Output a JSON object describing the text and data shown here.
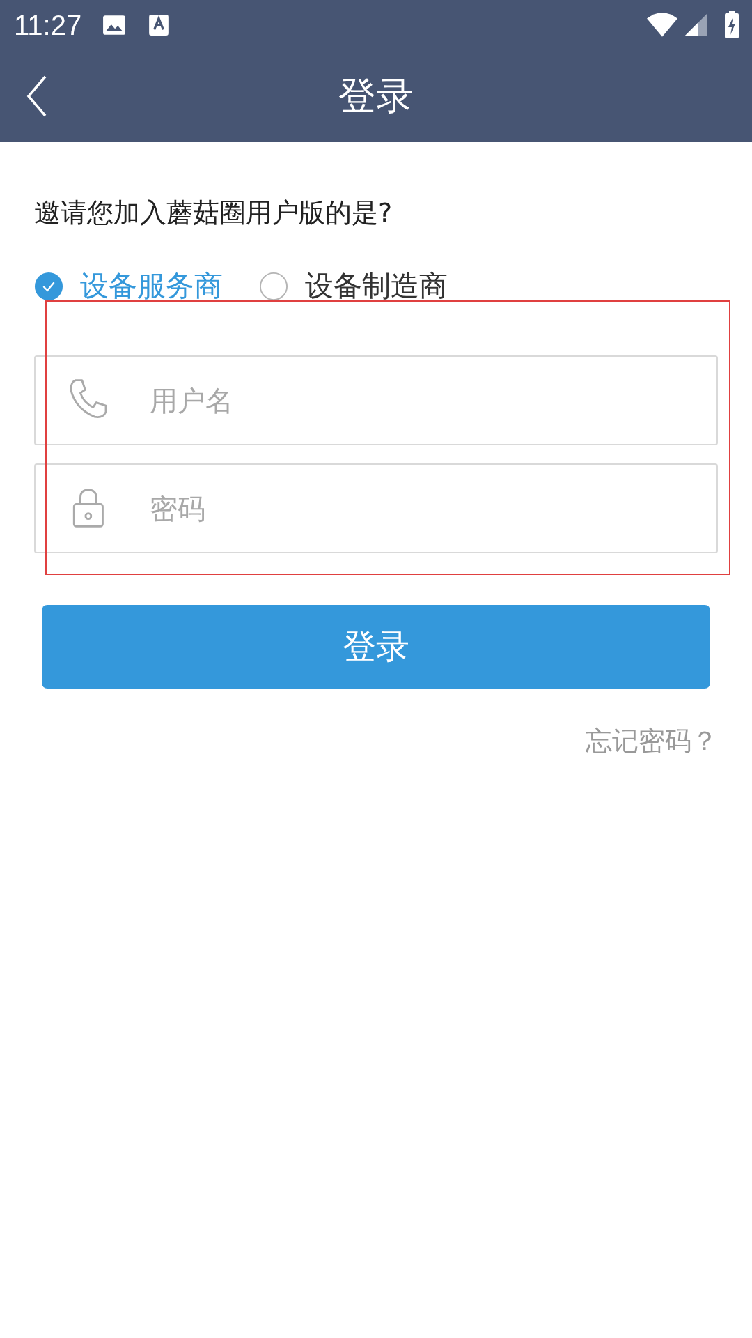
{
  "status_bar": {
    "time": "11:27"
  },
  "header": {
    "title": "登录"
  },
  "question": "邀请您加入蘑菇圈用户版的是?",
  "roles": [
    {
      "label": "设备服务商",
      "selected": true
    },
    {
      "label": "设备制造商",
      "selected": false
    }
  ],
  "fields": [
    {
      "kind": "phone",
      "placeholder": "用户名"
    },
    {
      "kind": "lock",
      "placeholder": "密码"
    }
  ],
  "login_button": "登录",
  "forgot_link": "忘记密码？"
}
